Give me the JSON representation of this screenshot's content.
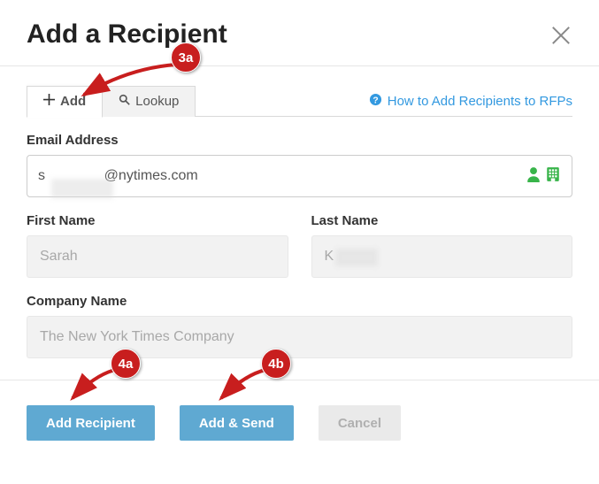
{
  "dialog": {
    "title": "Add a Recipient"
  },
  "tabs": {
    "add": "Add",
    "lookup": "Lookup"
  },
  "help_link": "How to Add Recipients to RFPs",
  "form": {
    "email_label": "Email Address",
    "email_value": "s               @nytimes.com",
    "first_name_label": "First Name",
    "first_name_value": "Sarah",
    "last_name_label": "Last Name",
    "last_name_value": "K",
    "company_label": "Company Name",
    "company_value": "The New York Times Company"
  },
  "buttons": {
    "add_recipient": "Add Recipient",
    "add_send": "Add & Send",
    "cancel": "Cancel"
  },
  "callouts": {
    "c3a": "3a",
    "c4a": "4a",
    "c4b": "4b"
  }
}
